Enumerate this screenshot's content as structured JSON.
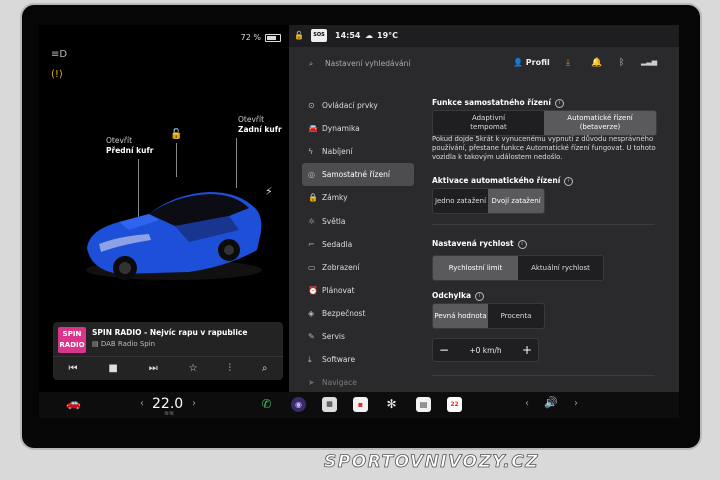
{
  "car_panel": {
    "battery_pct": "72 %",
    "battery_level": 0.72,
    "front_trunk_label": "Otevřít",
    "front_trunk_name": "Přední kufr",
    "rear_trunk_label": "Otevřít",
    "rear_trunk_name": "Zadní kufr",
    "car_color": "#1e4fd8"
  },
  "media": {
    "logo_line1": "SPIN",
    "logo_line2": "RADIO",
    "title": "SPIN RADIO - Nejvíc rapu v rapublice",
    "source": "DAB Radio Spin",
    "controls": [
      "prev-icon",
      "stop-icon",
      "next-icon",
      "star-icon",
      "equalizer-icon",
      "search-icon"
    ]
  },
  "status": {
    "badge": "SOS",
    "time": "14:54",
    "temp": "19°C"
  },
  "search": {
    "placeholder": "Nastavení vyhledávání"
  },
  "profile": {
    "label": "Profil"
  },
  "menu": [
    {
      "label": "Ovládací prvky",
      "icon": "toggle-icon"
    },
    {
      "label": "Dynamika",
      "icon": "car-icon"
    },
    {
      "label": "Nabíjení",
      "icon": "bolt-icon"
    },
    {
      "label": "Samostatné řízení",
      "icon": "steering-icon",
      "active": true
    },
    {
      "label": "Zámky",
      "icon": "lock-icon"
    },
    {
      "label": "Světla",
      "icon": "light-icon"
    },
    {
      "label": "Sedadla",
      "icon": "seat-icon"
    },
    {
      "label": "Zobrazení",
      "icon": "display-icon"
    },
    {
      "label": "Plánovat",
      "icon": "clock-icon"
    },
    {
      "label": "Bezpečnost",
      "icon": "shield-icon"
    },
    {
      "label": "Servis",
      "icon": "wrench-icon"
    },
    {
      "label": "Software",
      "icon": "download-icon"
    },
    {
      "label": "Navigace",
      "icon": "navigation-icon"
    }
  ],
  "autopilot": {
    "features_title": "Funkce samostatného řízení",
    "opt_tempomat_1": "Adaptivní",
    "opt_tempomat_2": "tempomat",
    "opt_auto_1": "Automatické řízení",
    "opt_auto_2": "(betaverze)",
    "note": "Pokud dojde 5krát k vynucenému vypnutí z důvodu nesprávného používání, přestane funkce Automatické řízení fungovat. U tohoto vozidla k takovým událostem nedošlo.",
    "activation_title": "Aktivace automatického řízení",
    "opt_single": "Jedno zatažení",
    "opt_double": "Dvojí zatažení",
    "speed_title": "Nastavená rychlost",
    "opt_limit": "Rychlostní limit",
    "opt_current": "Aktuální rychlost",
    "offset_title": "Odchylka",
    "opt_fixed": "Pevná hodnota",
    "opt_percent": "Procenta",
    "offset_value": "+0 km/h",
    "minus": "−",
    "plus": "+"
  },
  "taskbar": {
    "temp_value": "22.0",
    "calendar_day": "22",
    "left_arrow": "‹",
    "right_arrow": "›"
  },
  "watermark": "SPORTOVNIVOZY.CZ"
}
